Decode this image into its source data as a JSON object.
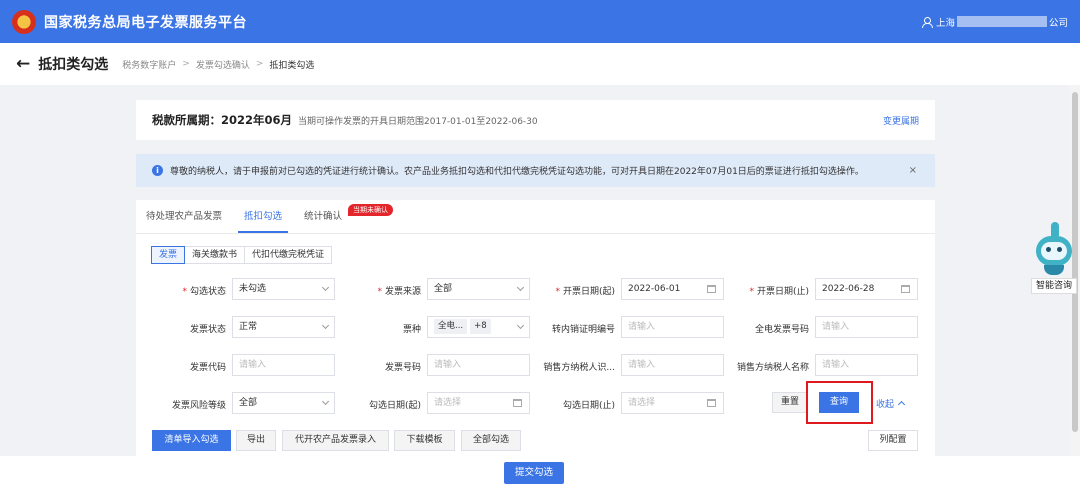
{
  "header": {
    "title": "国家税务总局电子发票服务平台",
    "user_prefix": "上海",
    "user_suffix": "公司"
  },
  "subheader": {
    "back_icon": "←",
    "title": "抵扣类勾选",
    "breadcrumb": [
      "税务数字账户",
      "发票勾选确认",
      "抵扣类勾选"
    ]
  },
  "period": {
    "label": "税款所属期：2022年06月",
    "desc": "当期可操作发票的开具日期范围2017-01-01至2022-06-30",
    "link": "变更属期"
  },
  "notice": {
    "icon": "i",
    "text": "尊敬的纳税人，请于申报前对已勾选的凭证进行统计确认。农产品业务抵扣勾选和代扣代缴完税凭证勾选功能，可对开具日期在2022年07月01日后的票证进行抵扣勾选操作。",
    "close": "×"
  },
  "tabs": [
    {
      "label": "待处理农产品发票"
    },
    {
      "label": "抵扣勾选"
    },
    {
      "label": "统计确认",
      "badge": "当期未确认"
    }
  ],
  "doc_types": [
    "发票",
    "海关缴款书",
    "代扣代缴完税凭证"
  ],
  "form": {
    "f1": {
      "label": "勾选状态",
      "value": "未勾选"
    },
    "f2": {
      "label": "发票来源",
      "value": "全部"
    },
    "f3": {
      "label": "开票日期(起)",
      "value": "2022-06-01"
    },
    "f4": {
      "label": "开票日期(止)",
      "value": "2022-06-28"
    },
    "f5": {
      "label": "发票状态",
      "value": "正常"
    },
    "f6": {
      "label": "票种",
      "tag": "全电...",
      "more": "+8"
    },
    "f7": {
      "label": "转内销证明编号",
      "placeholder": "请输入"
    },
    "f8": {
      "label": "全电发票号码",
      "placeholder": "请输入"
    },
    "f9": {
      "label": "发票代码",
      "placeholder": "请输入"
    },
    "f10": {
      "label": "发票号码",
      "placeholder": "请输入"
    },
    "f11": {
      "label": "销售方纳税人识...",
      "placeholder": "请输入"
    },
    "f12": {
      "label": "销售方纳税人名称",
      "placeholder": "请输入"
    },
    "f13": {
      "label": "发票风险等级",
      "value": "全部"
    },
    "f14": {
      "label": "勾选日期(起)",
      "placeholder": "请选择"
    },
    "f15": {
      "label": "勾选日期(止)",
      "placeholder": "请选择"
    }
  },
  "actions": {
    "reset": "重置",
    "query": "查询",
    "collapse": "收起"
  },
  "toolbar": {
    "import": "清单导入勾选",
    "export": "导出",
    "agri": "代开农产品发票录入",
    "template": "下载模板",
    "select_all": "全部勾选",
    "columns": "列配置"
  },
  "footer": {
    "submit": "提交勾选"
  },
  "assistant": {
    "label": "智能咨询"
  },
  "colors": {
    "primary": "#3a74e5",
    "highlight": "#e0191f",
    "badge": "#e3262c"
  }
}
